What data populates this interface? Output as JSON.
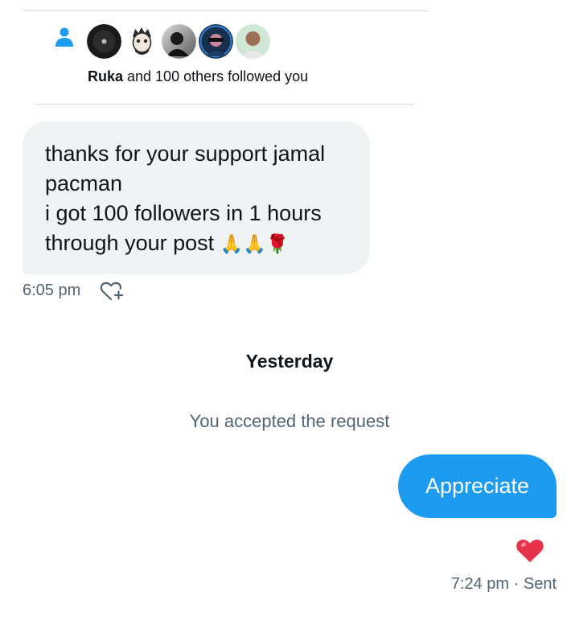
{
  "notification": {
    "icon": "person-icon",
    "avatars": [
      "avatar-1",
      "avatar-2",
      "avatar-3",
      "avatar-4",
      "avatar-5"
    ],
    "bold_name": "Ruka",
    "rest_text": " and 100 others followed you"
  },
  "incoming": {
    "lines": [
      "thanks for your support jamal",
      "pacman",
      "i got 100 followers in 1 hours",
      "through your post "
    ],
    "emojis": "🙏🙏🌹",
    "time": "6:05 pm",
    "react_icon": "heart-plus-icon"
  },
  "day_separator": "Yesterday",
  "system_message": "You accepted the request",
  "outgoing": {
    "text": "Appreciate",
    "reaction": "❤️",
    "time": "7:24 pm",
    "status": " · Sent"
  },
  "colors": {
    "accent": "#1d9bf0",
    "bubble_in": "#eff3f4",
    "muted_text": "#536471"
  }
}
